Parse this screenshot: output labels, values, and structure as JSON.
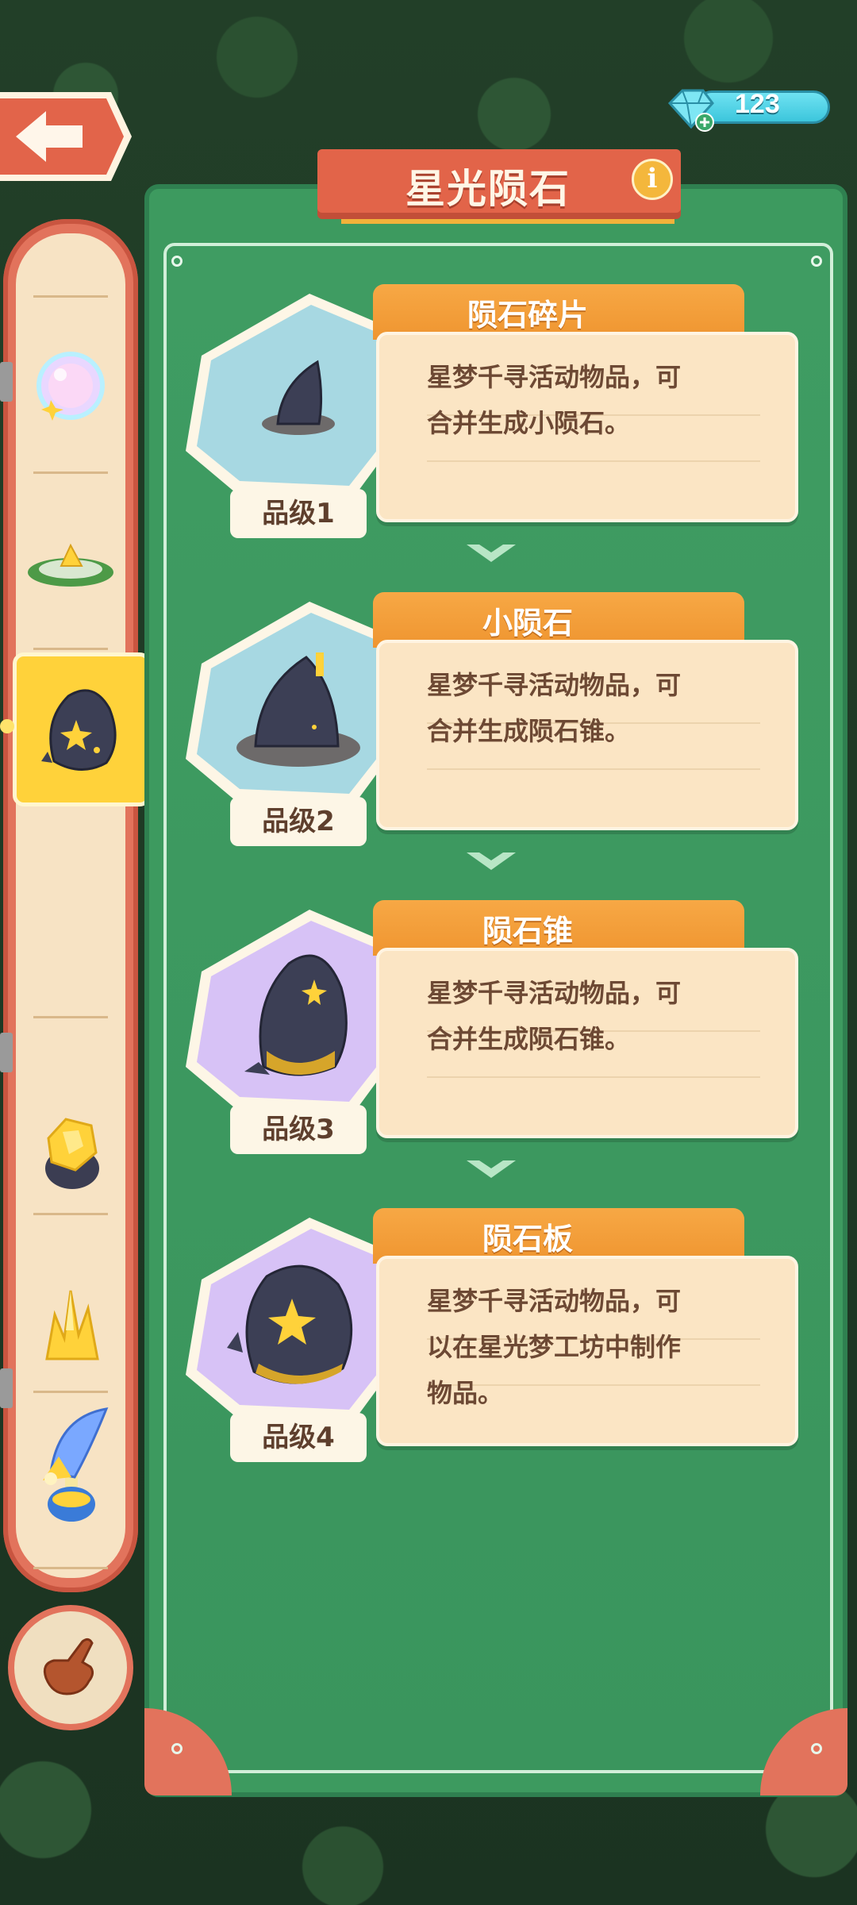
{
  "title": "星光陨石",
  "currency": {
    "amount": "123",
    "icon": "gem-icon",
    "color": "#4ccde0"
  },
  "sidebar": {
    "items": [
      {
        "icon": "bubble-star-icon"
      },
      {
        "icon": "grass-crystal-icon"
      },
      {
        "icon": "meteorite-icon",
        "selected": true
      },
      {
        "icon": "gold-nugget-icon"
      },
      {
        "icon": "gold-crystal-icon"
      },
      {
        "icon": "potion-icon"
      },
      {
        "icon": "wing-icon"
      }
    ]
  },
  "cards": [
    {
      "name": "陨石碎片",
      "line1": "星梦千寻活动物品，可",
      "line2": "合并生成小陨石。",
      "line3": "",
      "grade": "品级1",
      "bg": "blue"
    },
    {
      "name": "小陨石",
      "line1": "星梦千寻活动物品，可",
      "line2": "合并生成陨石锥。",
      "line3": "",
      "grade": "品级2",
      "bg": "blue"
    },
    {
      "name": "陨石锥",
      "line1": "星梦千寻活动物品，可",
      "line2": "合并生成陨石锥。",
      "line3": "",
      "grade": "品级3",
      "bg": "purple"
    },
    {
      "name": "陨石板",
      "line1": "星梦千寻活动物品，可",
      "line2": "以在星光梦工坊中制作",
      "line3": "物品。",
      "grade": "品级4",
      "bg": "purple"
    }
  ],
  "colors": {
    "panel": "#3d9a5f",
    "banner": "#e26449",
    "tab": "#f2a040",
    "selected": "#ffd23a"
  }
}
